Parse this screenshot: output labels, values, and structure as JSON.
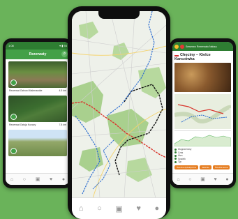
{
  "left_app": {
    "status_time": "1:08",
    "status_right": "▾ ▮ 93",
    "header_title": "Rezerwaty",
    "reserves": [
      {
        "name": "Rezerwat Ostrowi Mahmawide",
        "distance": "4.5 km",
        "thumb": "forest"
      },
      {
        "name": "Rezerwat Ostoja Kozacy",
        "distance": "7.8 km",
        "thumb": "river"
      },
      {
        "name": "",
        "distance": "",
        "thumb": "plain"
      }
    ],
    "nav_icons": [
      "home-icon",
      "search-icon",
      "grid-icon",
      "heart-icon",
      "user-icon"
    ]
  },
  "right_app": {
    "header_text": "Sewerwo Rezerwatu Natury",
    "title": "Chęciny – Kielce Karczówka",
    "legend": [
      "Długość trasy",
      "Czas",
      "Wzn.",
      "Spadek",
      "Typ"
    ],
    "tags": [
      "Ścieżka dydaktyczna",
      "Jaskinie",
      "Ścieżka leśna"
    ],
    "nav_icons": [
      "home-icon",
      "search-icon",
      "grid-icon",
      "heart-icon",
      "user-icon"
    ]
  },
  "center_app": {
    "nav_icons": [
      "home-icon",
      "search-icon",
      "grid-icon",
      "heart-icon",
      "user-icon"
    ]
  },
  "colors": {
    "background": "#6ab35a",
    "brand_green": "#2e7d32",
    "route_black": "#111111",
    "route_red": "#d9342b",
    "route_blue": "#2f6fd1"
  }
}
